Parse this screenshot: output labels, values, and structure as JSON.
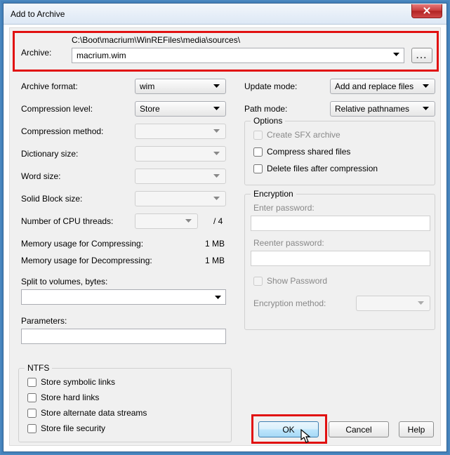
{
  "title": "Add to Archive",
  "archive": {
    "label": "Archive:",
    "path": "C:\\Boot\\macrium\\WinREFiles\\media\\sources\\",
    "filename": "macrium.wim",
    "browse": "..."
  },
  "left": {
    "archive_format": {
      "label": "Archive format:",
      "value": "wim"
    },
    "compression_level": {
      "label": "Compression level:",
      "value": "Store"
    },
    "compression_method": {
      "label": "Compression method:",
      "value": ""
    },
    "dictionary_size": {
      "label": "Dictionary size:",
      "value": ""
    },
    "word_size": {
      "label": "Word size:",
      "value": ""
    },
    "solid_block_size": {
      "label": "Solid Block size:",
      "value": ""
    },
    "cpu_threads": {
      "label": "Number of CPU threads:",
      "value": "",
      "suffix": "/ 4"
    },
    "mem_compress": {
      "label": "Memory usage for Compressing:",
      "value": "1 MB"
    },
    "mem_decompress": {
      "label": "Memory usage for Decompressing:",
      "value": "1 MB"
    },
    "split_volumes": {
      "label": "Split to volumes, bytes:",
      "value": ""
    },
    "parameters": {
      "label": "Parameters:",
      "value": ""
    }
  },
  "right": {
    "update_mode": {
      "label": "Update mode:",
      "value": "Add and replace files"
    },
    "path_mode": {
      "label": "Path mode:",
      "value": "Relative pathnames"
    },
    "options": {
      "legend": "Options",
      "sfx": "Create SFX archive",
      "shared": "Compress shared files",
      "delete_after": "Delete files after compression"
    },
    "encryption": {
      "legend": "Encryption",
      "enter": "Enter password:",
      "reenter": "Reenter password:",
      "show": "Show Password",
      "method": "Encryption method:"
    }
  },
  "ntfs": {
    "legend": "NTFS",
    "symlinks": "Store symbolic links",
    "hardlinks": "Store hard links",
    "ads": "Store alternate data streams",
    "security": "Store file security"
  },
  "footer": {
    "ok": "OK",
    "cancel": "Cancel",
    "help": "Help"
  }
}
